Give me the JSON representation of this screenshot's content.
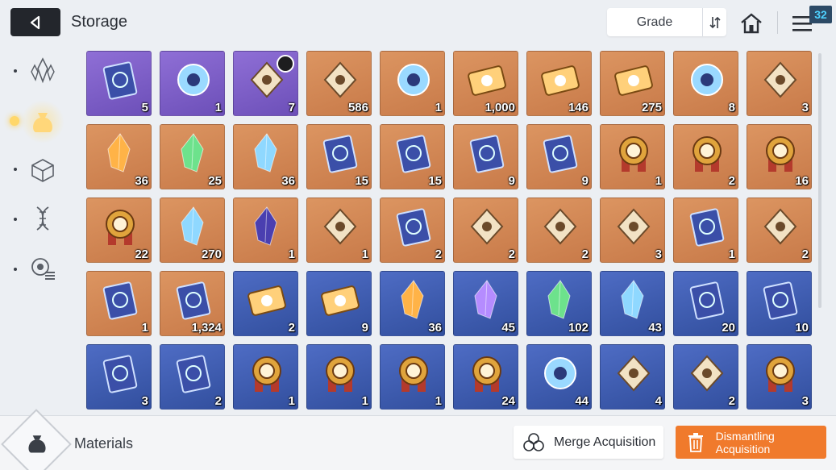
{
  "header": {
    "title": "Storage",
    "sort_label": "Grade",
    "notification_count": "32"
  },
  "side_nav": [
    {
      "icon": "crystals-icon",
      "active": false
    },
    {
      "icon": "materials-pouch-icon",
      "active": true
    },
    {
      "icon": "cube-icon",
      "active": false
    },
    {
      "icon": "dna-icon",
      "active": false
    },
    {
      "icon": "gear-list-icon",
      "active": false
    }
  ],
  "items": [
    {
      "icon": "scroll-icon",
      "grade": "purple",
      "count": "5"
    },
    {
      "icon": "orb-icon",
      "grade": "purple",
      "count": "1"
    },
    {
      "icon": "pyramid-icon",
      "grade": "purple",
      "count": "7",
      "timer": true
    },
    {
      "icon": "blue-creature-icon",
      "grade": "orange",
      "count": "586"
    },
    {
      "icon": "cyan-orb-icon",
      "grade": "orange",
      "count": "1"
    },
    {
      "icon": "chip-icon",
      "grade": "orange",
      "count": "1,000"
    },
    {
      "icon": "golden-ticket-icon",
      "grade": "orange",
      "count": "146"
    },
    {
      "icon": "star-ticket-icon",
      "grade": "orange",
      "count": "275"
    },
    {
      "icon": "eye-icon",
      "grade": "orange",
      "count": "8"
    },
    {
      "icon": "feather-icon",
      "grade": "orange",
      "count": "3"
    },
    {
      "icon": "fire-crystal-icon",
      "grade": "orange",
      "count": "36"
    },
    {
      "icon": "green-crystal-icon",
      "grade": "orange",
      "count": "25"
    },
    {
      "icon": "blue-crystal-icon",
      "grade": "orange",
      "count": "36"
    },
    {
      "icon": "sword-book-icon",
      "grade": "orange",
      "count": "15"
    },
    {
      "icon": "shield-book-icon",
      "grade": "orange",
      "count": "15"
    },
    {
      "icon": "target-book-icon",
      "grade": "orange",
      "count": "9"
    },
    {
      "icon": "bolt-book-icon",
      "grade": "orange",
      "count": "9"
    },
    {
      "icon": "sword-medal-icon",
      "grade": "orange",
      "count": "1"
    },
    {
      "icon": "shield-medal-icon",
      "grade": "orange",
      "count": "2"
    },
    {
      "icon": "target-medal-icon",
      "grade": "orange",
      "count": "16"
    },
    {
      "icon": "compass-medal-icon",
      "grade": "orange",
      "count": "22"
    },
    {
      "icon": "shards-icon",
      "grade": "orange",
      "count": "270"
    },
    {
      "icon": "dark-crystal-icon",
      "grade": "orange",
      "count": "1"
    },
    {
      "icon": "sneakers-icon",
      "grade": "orange",
      "count": "1"
    },
    {
      "icon": "star-map-book-icon",
      "grade": "orange",
      "count": "2"
    },
    {
      "icon": "spray-gun-icon",
      "grade": "orange",
      "count": "2"
    },
    {
      "icon": "cards-icon",
      "grade": "orange",
      "count": "2"
    },
    {
      "icon": "dreamcatcher-icon",
      "grade": "orange",
      "count": "3"
    },
    {
      "icon": "leather-book-icon",
      "grade": "orange",
      "count": "1"
    },
    {
      "icon": "guitar-pick-icon",
      "grade": "orange",
      "count": "2"
    },
    {
      "icon": "manual-icon",
      "grade": "orange",
      "count": "1"
    },
    {
      "icon": "music-scroll-icon",
      "grade": "orange",
      "count": "1,324"
    },
    {
      "icon": "blue-ticket-icon",
      "grade": "blue",
      "count": "2"
    },
    {
      "icon": "blue-star-ticket-icon",
      "grade": "blue",
      "count": "9"
    },
    {
      "icon": "orange-shard-icon",
      "grade": "blue",
      "count": "36"
    },
    {
      "icon": "purple-shard-icon",
      "grade": "blue",
      "count": "45"
    },
    {
      "icon": "green-shard-icon",
      "grade": "blue",
      "count": "102"
    },
    {
      "icon": "cyan-shard-icon",
      "grade": "blue",
      "count": "43"
    },
    {
      "icon": "blue-sword-book-icon",
      "grade": "blue",
      "count": "20"
    },
    {
      "icon": "blue-shield-book-icon",
      "grade": "blue",
      "count": "10"
    },
    {
      "icon": "blue-target-book-icon",
      "grade": "blue",
      "count": "3"
    },
    {
      "icon": "blue-bolt-book-icon",
      "grade": "blue",
      "count": "2"
    },
    {
      "icon": "silver-shield-medal-icon",
      "grade": "blue",
      "count": "1"
    },
    {
      "icon": "silver-target-medal-icon",
      "grade": "blue",
      "count": "1"
    },
    {
      "icon": "silver-bolt-medal-icon",
      "grade": "blue",
      "count": "1"
    },
    {
      "icon": "silver-compass-medal-icon",
      "grade": "blue",
      "count": "24"
    },
    {
      "icon": "ice-gem-icon",
      "grade": "blue",
      "count": "44"
    },
    {
      "icon": "cake-icon",
      "grade": "blue",
      "count": "4"
    },
    {
      "icon": "pocket-watch-icon",
      "grade": "blue",
      "count": "2"
    },
    {
      "icon": "star-badge-icon",
      "grade": "blue",
      "count": "3"
    }
  ],
  "footer": {
    "category_label": "Materials",
    "merge_label": "Merge Acquisition",
    "dismantle_label": "Dismantling Acquisition"
  },
  "colors": {
    "orange_grade": "#d0824f",
    "purple_grade": "#7d5fc8",
    "blue_grade": "#3f5db2",
    "accent_button": "#f07a2c"
  }
}
